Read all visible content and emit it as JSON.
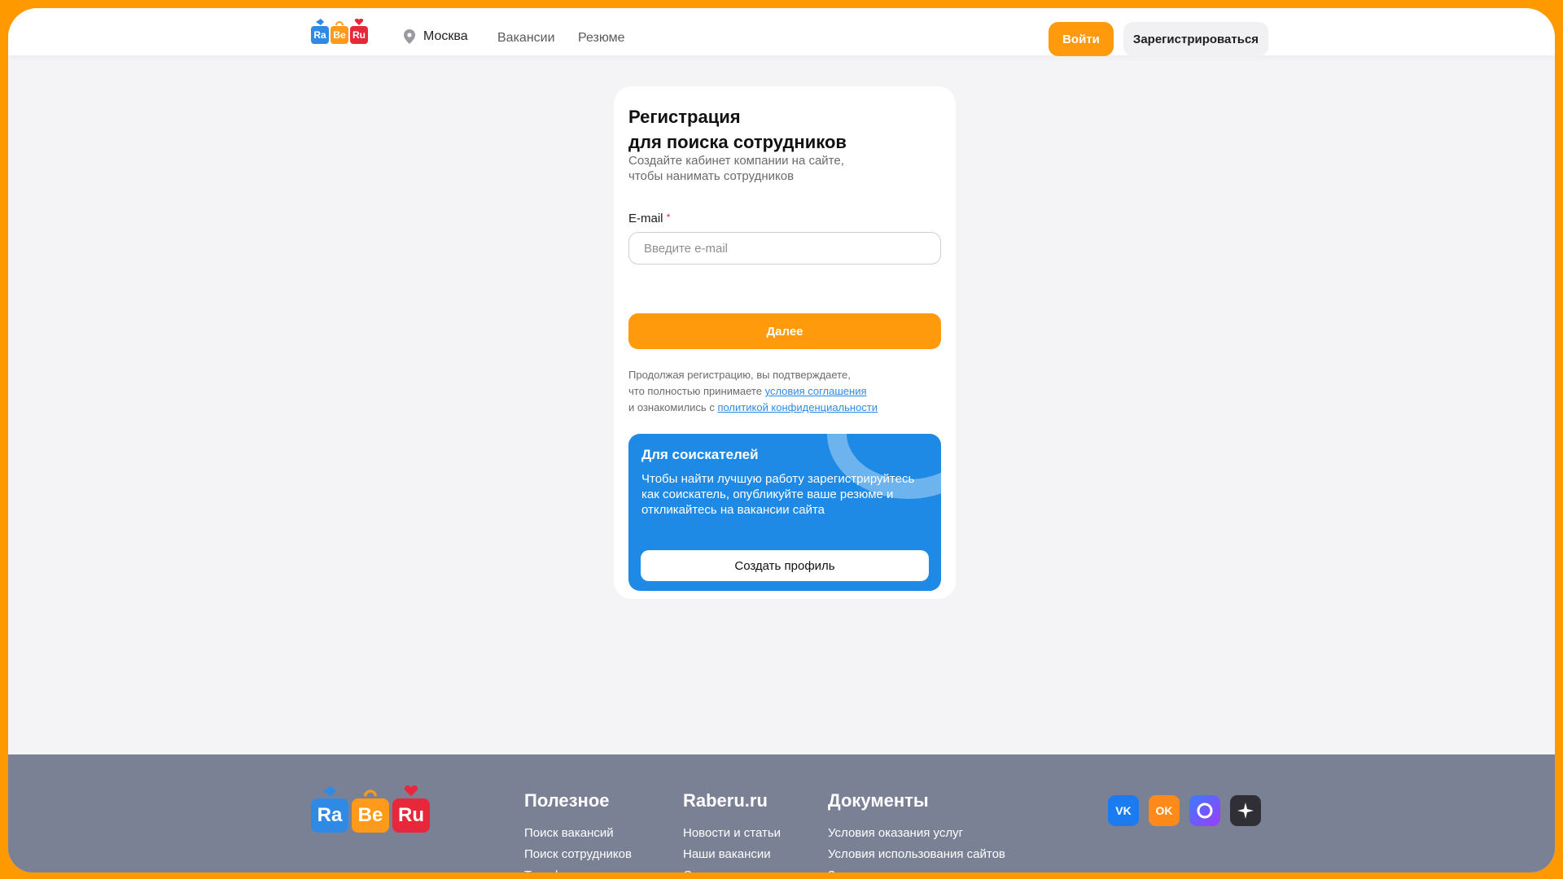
{
  "header": {
    "logo": [
      "Ra",
      "Be",
      "Ru"
    ],
    "city": "Москва",
    "nav": [
      "Вакансии",
      "Резюме"
    ],
    "login_label": "Войти",
    "register_label": "Зарегистрироваться"
  },
  "form": {
    "title_line1": "Регистрация",
    "title_line2": "для поиска сотрудников",
    "subtitle_line1": "Создайте кабинет компании на сайте,",
    "subtitle_line2": "чтобы нанимать сотрудников",
    "email_label": "E-mail",
    "email_required_mark": "*",
    "email_placeholder": "Введите e-mail",
    "email_value": "",
    "next_label": "Далее",
    "legal_line1": "Продолжая регистрацию, вы подтверждаете,",
    "legal_line2_prefix": "что полностью принимаете",
    "legal_terms_link": "условия соглашения",
    "legal_line3_prefix": "и ознакомились с",
    "legal_privacy_link": "политикой конфиденциальности"
  },
  "seeker": {
    "title": "Для соискателей",
    "text": "Чтобы найти лучшую работу зарегистрируйтесь как соискатель, опубликуйте ваше резюме и откликайтесь на вакансии сайта",
    "button_label": "Создать профиль"
  },
  "footer": {
    "columns": [
      {
        "title": "Полезное",
        "items": [
          "Поиск вакансий",
          "Поиск сотрудников",
          "Тарифы и оплата"
        ]
      },
      {
        "title": "Raberu.ru",
        "items": [
          "Новости и статьи",
          "Наши вакансии",
          "О компании"
        ]
      },
      {
        "title": "Документы",
        "items": [
          "Условия оказания услуг",
          "Условия использования сайтов",
          "Защита персональных данных"
        ]
      }
    ],
    "social": [
      {
        "name": "vk-icon",
        "label": "VK"
      },
      {
        "name": "odnoklassniki-icon",
        "label": "OK"
      },
      {
        "name": "max-messenger-icon",
        "label": ""
      },
      {
        "name": "ai-star-icon",
        "label": ""
      }
    ]
  },
  "colors": {
    "accent": "#ff9a0d",
    "blue": "#1f8ae5",
    "footer": "#7b8194",
    "frame": "#ff9900"
  }
}
